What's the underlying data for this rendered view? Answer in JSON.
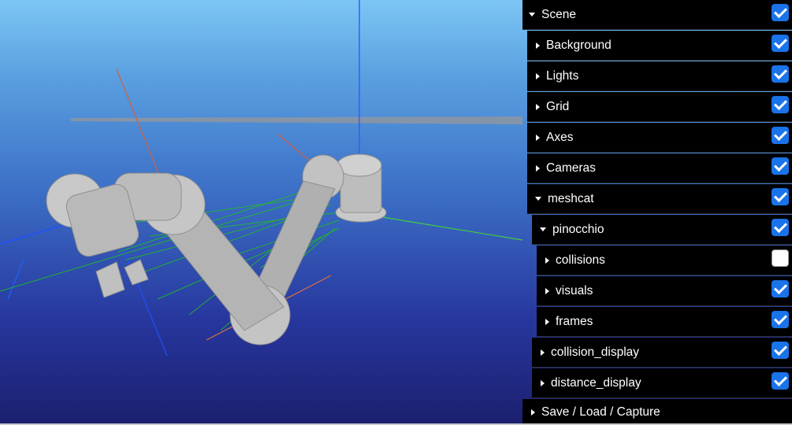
{
  "colors": {
    "checkbox_on": "#1a73e8",
    "panel_bg": "#000000",
    "panel_text": "#ffffff"
  },
  "scene_tree": [
    {
      "label": "Scene",
      "expanded": true,
      "checked": true
    },
    {
      "label": "Background",
      "expanded": false,
      "checked": true
    },
    {
      "label": "Lights",
      "expanded": false,
      "checked": true
    },
    {
      "label": "Grid",
      "expanded": false,
      "checked": true
    },
    {
      "label": "Axes",
      "expanded": false,
      "checked": true
    },
    {
      "label": "Cameras",
      "expanded": false,
      "checked": true
    },
    {
      "label": "meshcat",
      "expanded": true,
      "checked": true
    },
    {
      "label": "pinocchio",
      "expanded": true,
      "checked": true
    },
    {
      "label": "collisions",
      "expanded": false,
      "checked": false
    },
    {
      "label": "visuals",
      "expanded": false,
      "checked": true
    },
    {
      "label": "frames",
      "expanded": false,
      "checked": true
    },
    {
      "label": "collision_display",
      "expanded": false,
      "checked": true
    },
    {
      "label": "distance_display",
      "expanded": false,
      "checked": true
    },
    {
      "label": "Save / Load / Capture",
      "expanded": false
    }
  ]
}
